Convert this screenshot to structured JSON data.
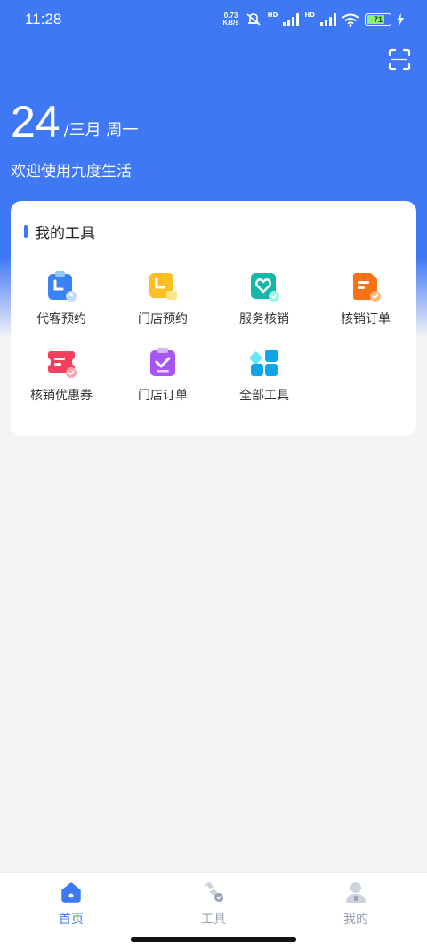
{
  "status_bar": {
    "time": "11:28",
    "net_speed_value": "0.73",
    "net_speed_unit": "KB/s",
    "battery": "71",
    "signal_label_1": "HD",
    "signal_label_2": "HD"
  },
  "header": {
    "scan_icon": "scan-icon",
    "day": "24",
    "date_suffix": "/三月 周一",
    "welcome": "欢迎使用九度生活"
  },
  "tools": {
    "title": "我的工具",
    "items": [
      {
        "label": "代客预约",
        "icon": "clipboard-clock-icon"
      },
      {
        "label": "门店预约",
        "icon": "store-booking-icon"
      },
      {
        "label": "服务核销",
        "icon": "heart-check-icon"
      },
      {
        "label": "核销订单",
        "icon": "order-check-icon"
      },
      {
        "label": "核销优惠券",
        "icon": "coupon-check-icon"
      },
      {
        "label": "门店订单",
        "icon": "clipboard-check-icon"
      },
      {
        "label": "全部工具",
        "icon": "grid-icon"
      }
    ]
  },
  "tabbar": {
    "items": [
      {
        "label": "首页",
        "icon": "home-icon",
        "active": true
      },
      {
        "label": "工具",
        "icon": "wrench-icon",
        "active": false
      },
      {
        "label": "我的",
        "icon": "user-icon",
        "active": false
      }
    ]
  },
  "colors": {
    "primary": "#3f78f5",
    "background": "#f4f4f5",
    "tab_inactive": "#9aa3b2"
  }
}
